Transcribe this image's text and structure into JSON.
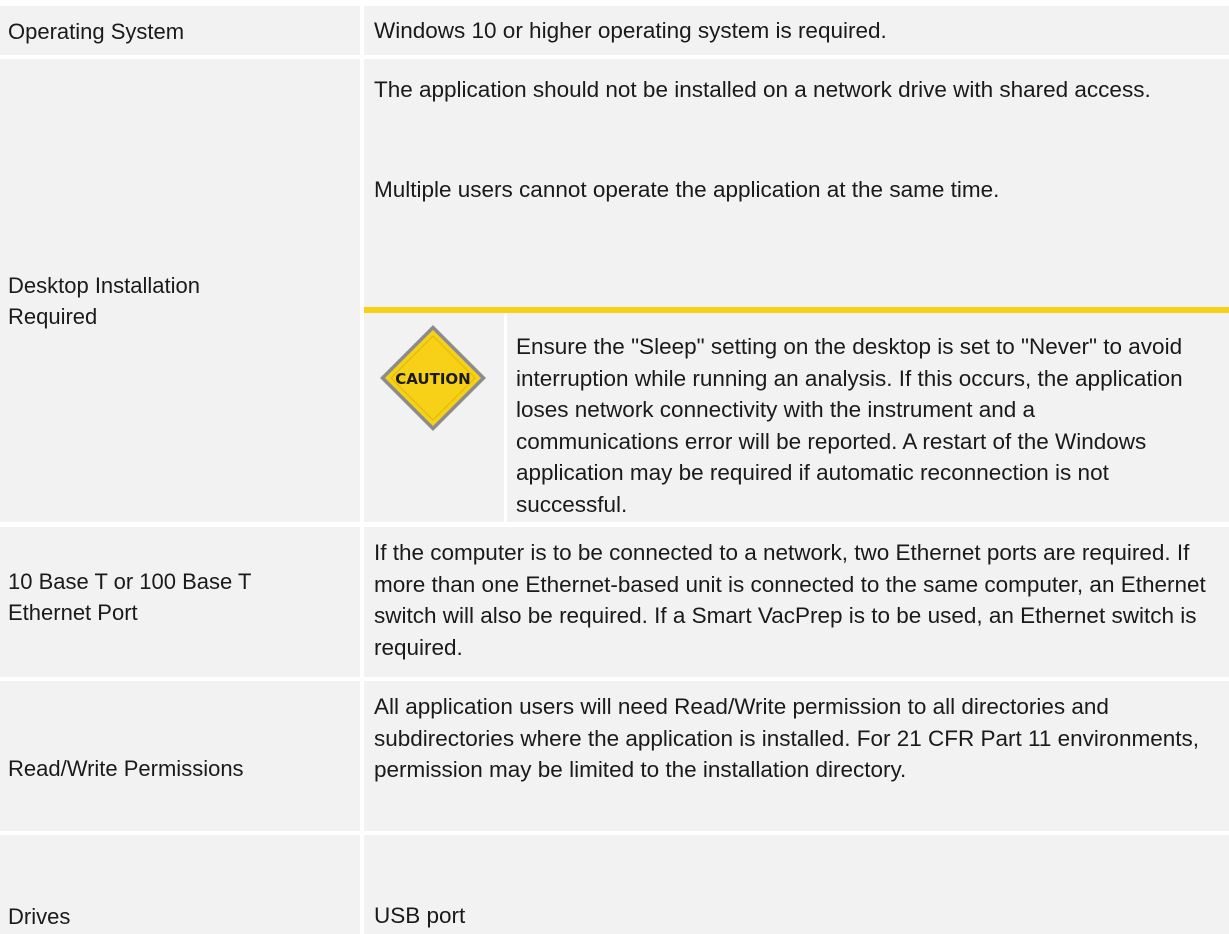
{
  "rows": [
    {
      "label": "Operating System",
      "paragraphs": [
        "Windows 10 or higher operating system is required."
      ]
    },
    {
      "label_lines": [
        "Desktop Installation",
        "Required"
      ],
      "paragraphs": [
        "The application should not be installed on a network drive with shared access.",
        "Multiple users cannot operate the application at the same time."
      ],
      "caution": {
        "icon_text": "CAUTION",
        "text": "Ensure the \"Sleep\" setting on the desktop is set to \"Never\" to avoid interruption while running an analysis. If this occurs, the application loses network connectivity with the instrument and a communications error will be reported. A restart of the Windows application may be required if automatic reconnection is not successful."
      }
    },
    {
      "label_lines": [
        "10 Base T or 100 Base T",
        "Ethernet Port"
      ],
      "paragraphs": [
        "If the computer is to be connected to a network, two Ethernet ports are required. If more than one Ethernet-based unit is connected to the same computer, an Ethernet switch will also be required. If a Smart VacPrep is to be used, an Ethernet switch is required."
      ]
    },
    {
      "label": "Read/Write Permissions",
      "paragraphs": [
        "All application users will need Read/Write permission to all directories and subdirectories where the application is installed. For 21 CFR Part 11 environments, permission may be limited to the installation directory."
      ]
    },
    {
      "label": "Drives",
      "paragraphs": [
        "USB port"
      ]
    }
  ],
  "colors": {
    "cell_background": "#f2f2f2",
    "caution_border": "#f7d117",
    "caution_sign_fill": "#f7d117",
    "text": "#1a1a1a"
  },
  "icons": {
    "caution": "caution-sign-icon"
  }
}
